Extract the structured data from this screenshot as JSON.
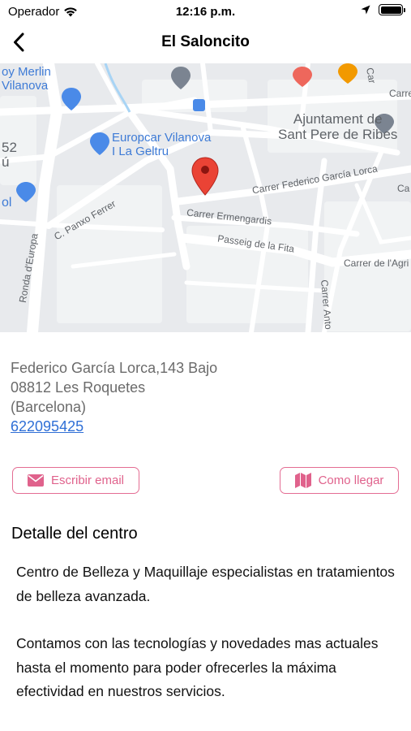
{
  "status_bar": {
    "carrier": "Operador",
    "time": "12:16 p.m."
  },
  "nav": {
    "title": "El Saloncito",
    "back_icon": "chevron-left-icon"
  },
  "map": {
    "labels": {
      "store_line1": "oy Merlin",
      "store_line2": "Vilanova",
      "europcar_line1": "Europcar Vilanova",
      "europcar_line2": "I La Geltru",
      "ajuntament_line1": "Ajuntament de",
      "ajuntament_line2": "Sant Pere de Ribes",
      "edge_num": "52",
      "edge_u": "ú",
      "edge_ol": "ol",
      "street_lorca": "Carrer Federico García Lorca",
      "street_ca": "Ca",
      "street_ermengardis": "Carrer Ermengardis",
      "street_panxo": "C. Panxo Ferrer",
      "street_fita": "Passeig de la Fita",
      "street_ronda": "Ronda d'Europa",
      "street_agri": "Carrer de l'Agri",
      "street_anto": "Carrer Anto",
      "street_carre": "Carre",
      "street_car_top": "Car"
    },
    "pin_color": "#ea4335"
  },
  "address": {
    "line1": "Federico García Lorca,143 Bajo",
    "line2": "08812 Les Roquetes",
    "line3": "(Barcelona)",
    "phone": "622095425"
  },
  "buttons": {
    "email_label": "Escribir email",
    "email_icon": "envelope-icon",
    "route_label": "Como llegar",
    "route_icon": "map-icon",
    "accent_color": "#e0628c"
  },
  "details": {
    "title": "Detalle del centro",
    "paragraph1": "Centro de Belleza y Maquillaje especialistas en tratamientos de belleza avanzada.",
    "paragraph2": "Contamos con las tecnologías y novedades mas actuales hasta el momento para poder ofrecerles la máxima efectividad en nuestros servicios."
  }
}
